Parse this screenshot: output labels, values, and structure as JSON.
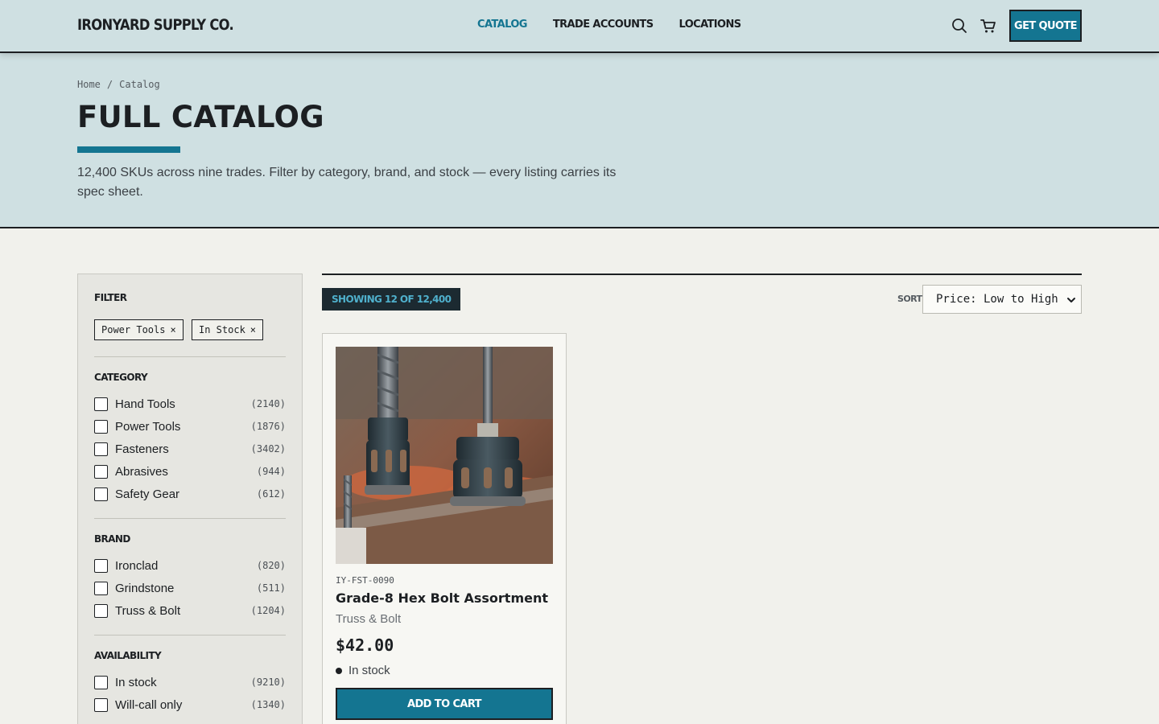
{
  "header": {
    "logo": "IRONYARD SUPPLY CO.",
    "nav": [
      {
        "label": "CATALOG",
        "active": true
      },
      {
        "label": "TRADE ACCOUNTS",
        "active": false
      },
      {
        "label": "LOCATIONS",
        "active": false
      }
    ],
    "search_icon": "search-icon",
    "cart_icon": "cart-icon",
    "quote_button": "GET QUOTE"
  },
  "hero": {
    "breadcrumb": [
      "Home",
      "/",
      "Catalog"
    ],
    "title": "FULL CATALOG",
    "description": "12,400 SKUs across nine trades. Filter by category, brand, and stock — every listing carries its spec sheet."
  },
  "filters": {
    "heading": "FILTER",
    "active_chips": [
      "Power Tools",
      "In Stock"
    ],
    "chip_remove_glyph": "×",
    "groups": [
      {
        "heading": "CATEGORY",
        "options": [
          {
            "label": "Hand Tools",
            "count": "(2140)",
            "checked": false
          },
          {
            "label": "Power Tools",
            "count": "(1876)",
            "checked": false
          },
          {
            "label": "Fasteners",
            "count": "(3402)",
            "checked": false
          },
          {
            "label": "Abrasives",
            "count": "(944)",
            "checked": false
          },
          {
            "label": "Safety Gear",
            "count": "(612)",
            "checked": false
          }
        ]
      },
      {
        "heading": "BRAND",
        "options": [
          {
            "label": "Ironclad",
            "count": "(820)",
            "checked": false
          },
          {
            "label": "Grindstone",
            "count": "(511)",
            "checked": false
          },
          {
            "label": "Truss & Bolt",
            "count": "(1204)",
            "checked": false
          }
        ]
      },
      {
        "heading": "AVAILABILITY",
        "options": [
          {
            "label": "In stock",
            "count": "(9210)",
            "checked": false
          },
          {
            "label": "Will-call only",
            "count": "(1340)",
            "checked": false
          }
        ]
      }
    ]
  },
  "results": {
    "showing": "SHOWING 12 OF 12,400",
    "sort_label": "SORT",
    "sort_value": "Price: Low to High"
  },
  "products": [
    {
      "sku": "IY-FST-0090",
      "name": "Grade-8 Hex Bolt Assortment",
      "brand": "Truss & Bolt",
      "price": "$42.00",
      "stock": "In stock",
      "button": "ADD TO CART"
    }
  ],
  "colors": {
    "accent": "#147591",
    "header_bg": "#cfe0e2",
    "page_bg": "#f1f1ec",
    "ink": "#1c1f22",
    "badge_bg": "#1c2a31",
    "badge_text": "#4fb0cc"
  }
}
